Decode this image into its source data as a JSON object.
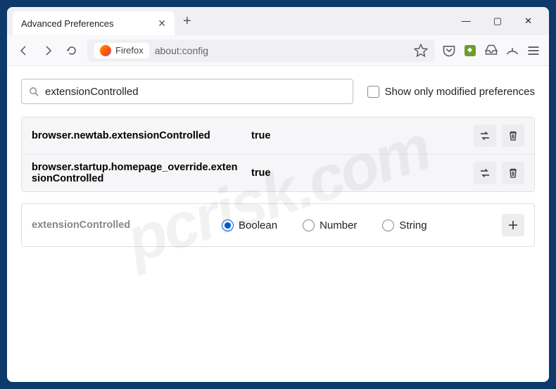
{
  "window": {
    "tab_title": "Advanced Preferences"
  },
  "toolbar": {
    "identity_label": "Firefox",
    "url": "about:config"
  },
  "search": {
    "value": "extensionControlled",
    "checkbox_label": "Show only modified preferences"
  },
  "prefs": [
    {
      "name": "browser.newtab.extensionControlled",
      "value": "true"
    },
    {
      "name": "browser.startup.homepage_override.extensionControlled",
      "value": "true"
    }
  ],
  "add": {
    "name": "extensionControlled",
    "types": [
      "Boolean",
      "Number",
      "String"
    ],
    "selected": "Boolean"
  },
  "watermark": "pcrisk.com"
}
